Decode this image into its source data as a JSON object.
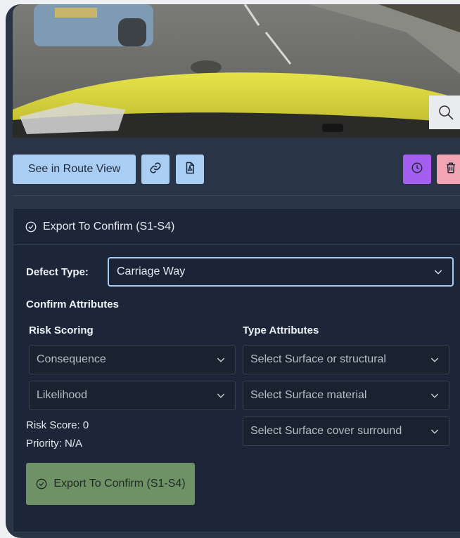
{
  "photo": {
    "zoom_icon": "magnifier-icon"
  },
  "actions": {
    "route_label": "See in Route View",
    "link_icon": "link-icon",
    "pdf_icon": "pdf-file-icon",
    "history_icon": "clock-icon",
    "delete_icon": "trash-icon"
  },
  "panel": {
    "header_label": "Export To Confirm (S1-S4)",
    "defect_type_label": "Defect Type:",
    "defect_type_value": "Carriage Way",
    "confirm_attributes_label": "Confirm Attributes",
    "risk_scoring_label": "Risk Scoring",
    "type_attributes_label": "Type Attributes",
    "consequence_placeholder": "Consequence",
    "likelihood_placeholder": "Likelihood",
    "surface_structural_placeholder": "Select Surface or structural",
    "surface_material_placeholder": "Select Surface material",
    "surface_cover_placeholder": "Select Surface cover surround",
    "risk_score_text": "Risk Score: 0",
    "priority_text": "Priority: N/A",
    "export_button_label": "Export To Confirm (S1-S4)"
  },
  "colors": {
    "card_bg": "#2a3447",
    "panel_bg": "#1c2638",
    "primary_light": "#a9cdf3",
    "history": "#a55ff0",
    "delete": "#f1a5b2",
    "export": "#6e9266"
  }
}
